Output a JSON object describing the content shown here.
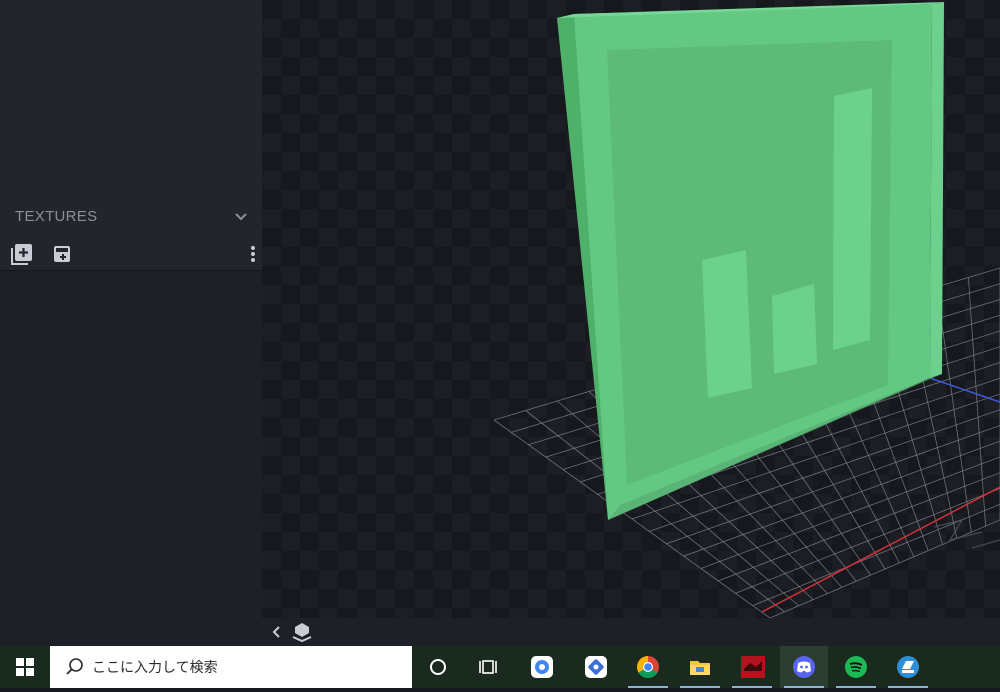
{
  "textures_panel": {
    "title": "TEXTURES"
  },
  "taskbar": {
    "search_placeholder": "ここに入力して検索",
    "apps": [
      {
        "name": "chrome-app-1",
        "running": false
      },
      {
        "name": "chrome-app-2",
        "running": false
      },
      {
        "name": "google-chrome",
        "running": true
      },
      {
        "name": "file-explorer",
        "running": true
      },
      {
        "name": "red-app",
        "running": true
      },
      {
        "name": "discord",
        "running": true
      },
      {
        "name": "spotify",
        "running": true
      },
      {
        "name": "blue-app",
        "running": true
      }
    ]
  },
  "colors": {
    "model_green": "#63c982",
    "axis_red": "#d1323a",
    "axis_blue": "#3b5bd9",
    "grid_line": "#8a8d95"
  },
  "icons": [
    "windows-logo-icon",
    "search-icon",
    "cortana-icon",
    "task-view-icon",
    "chevron-down-icon",
    "add-texture-icon",
    "import-texture-icon",
    "more-vert-icon",
    "chevron-left-icon",
    "ground-plane-icon"
  ]
}
